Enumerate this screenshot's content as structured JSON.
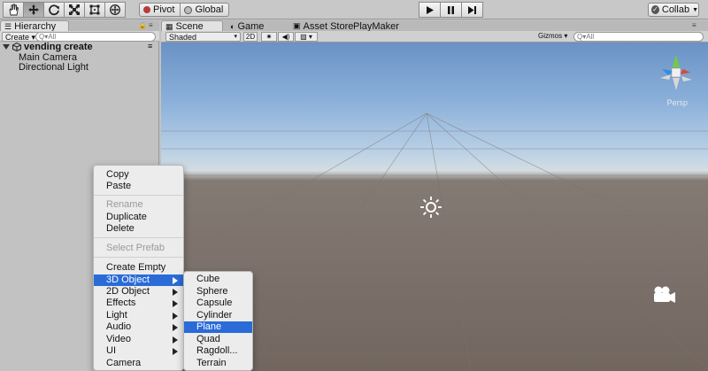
{
  "toolbar": {
    "tools": [
      "hand-icon",
      "move-icon",
      "rotate-icon",
      "scale-icon",
      "rect-tool-icon",
      "transform-icon"
    ],
    "pivot_label": "Pivot",
    "global_label": "Global",
    "play_icons": [
      "play-icon",
      "pause-icon",
      "step-icon"
    ],
    "collab_label": "Collab"
  },
  "hierarchy": {
    "tab_label": "Hierarchy",
    "create_label": "Create",
    "search_placeholder": "Q▾All",
    "scene_name": "vending create",
    "items": [
      "Main Camera",
      "Directional Light"
    ]
  },
  "scene_tabs": [
    {
      "label": "Scene",
      "icon": "scene-icon",
      "active": true
    },
    {
      "label": "Game",
      "icon": "game-icon",
      "active": false
    },
    {
      "label": "Asset Store",
      "icon": "asset-store-icon",
      "active": false
    },
    {
      "label": "PlayMaker",
      "icon": "",
      "active": false
    }
  ],
  "scene_toolbar": {
    "shading": "Shaded",
    "mode_2d": "2D",
    "gizmos_label": "Gizmos",
    "search_placeholder": "Q▾All"
  },
  "viewport": {
    "persp_label": "Persp",
    "icons": [
      "light-icon",
      "camera-icon",
      "axis-gizmo-icon"
    ]
  },
  "context_menu": {
    "groups": [
      [
        {
          "label": "Copy"
        },
        {
          "label": "Paste"
        }
      ],
      [
        {
          "label": "Rename",
          "disabled": true
        },
        {
          "label": "Duplicate"
        },
        {
          "label": "Delete"
        }
      ],
      [
        {
          "label": "Select Prefab",
          "disabled": true
        }
      ],
      [
        {
          "label": "Create Empty"
        },
        {
          "label": "3D Object",
          "submenu": true,
          "highlighted": true
        },
        {
          "label": "2D Object",
          "submenu": true
        },
        {
          "label": "Effects",
          "submenu": true
        },
        {
          "label": "Light",
          "submenu": true
        },
        {
          "label": "Audio",
          "submenu": true
        },
        {
          "label": "Video",
          "submenu": true
        },
        {
          "label": "UI",
          "submenu": true
        },
        {
          "label": "Camera"
        }
      ]
    ],
    "submenu_items": [
      {
        "label": "Cube"
      },
      {
        "label": "Sphere"
      },
      {
        "label": "Capsule"
      },
      {
        "label": "Cylinder"
      },
      {
        "label": "Plane",
        "highlighted": true
      },
      {
        "label": "Quad"
      },
      {
        "label": "Ragdoll..."
      },
      {
        "label": "Terrain"
      }
    ]
  },
  "colors": {
    "highlight": "#2a6bd8",
    "sky_top": "#6a92c4",
    "ground": "#72665f"
  }
}
